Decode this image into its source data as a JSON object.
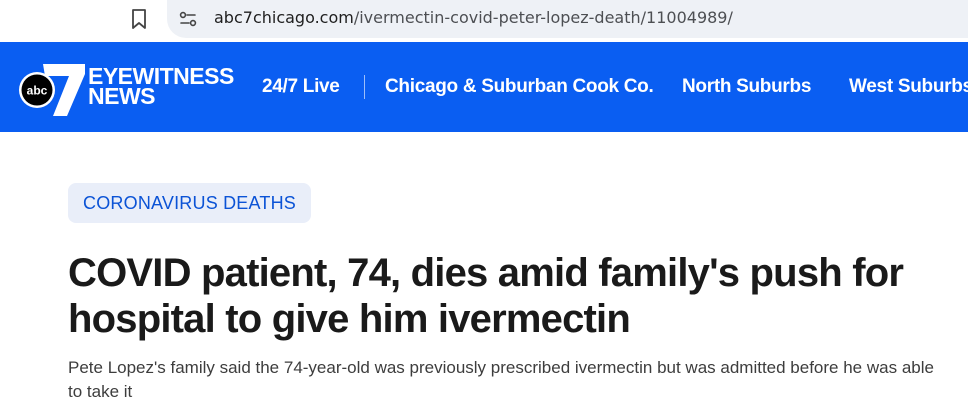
{
  "browser": {
    "url_host": "abc7chicago.com",
    "url_path": "/ivermectin-covid-peter-lopez-death/11004989/"
  },
  "site": {
    "logo_text": "abc",
    "logo_number": "7",
    "brand_line1": "EYEWITNESS",
    "brand_line2": "NEWS",
    "nav": [
      {
        "label": "24/7 Live"
      },
      {
        "label": "Chicago & Suburban Cook Co."
      },
      {
        "label": "North Suburbs"
      },
      {
        "label": "West Suburbs"
      }
    ],
    "colors": {
      "nav_bg": "#0a5ef2",
      "tag_bg": "#e9eef9",
      "tag_text": "#0b53d6"
    }
  },
  "article": {
    "tag": "CORONAVIRUS DEATHS",
    "headline": "COVID patient, 74, dies amid family's push for hospital to give him ivermectin",
    "dek": "Pete Lopez's family said the 74-year-old was previously prescribed ivermectin but was admitted before he was able to take it"
  }
}
